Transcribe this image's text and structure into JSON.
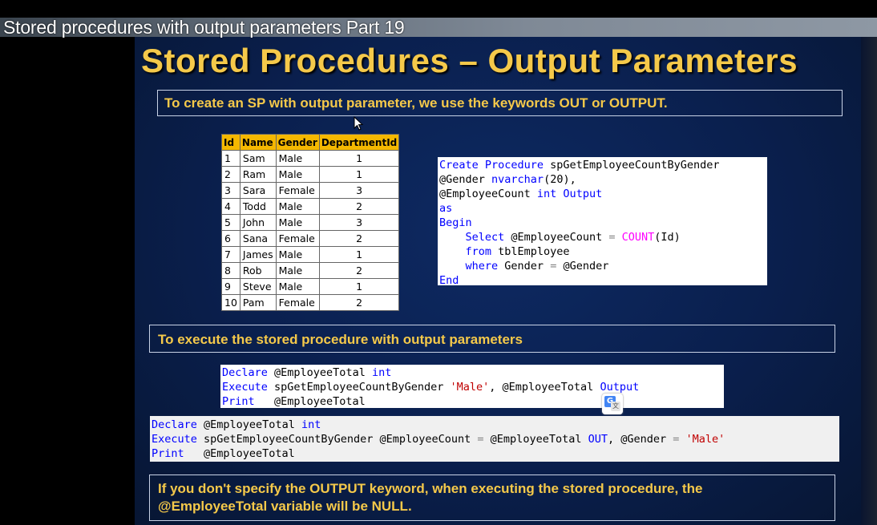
{
  "video": {
    "title": "Stored procedures with output parameters Part 19"
  },
  "slide": {
    "heading": "Stored Procedures – Output Parameters",
    "intro": "To create an SP with output parameter, we use the keywords OUT or OUTPUT.",
    "execute_heading": "To execute the stored procedure with output parameters",
    "note_line1": "If you don't specify the OUTPUT keyword, when executing the stored procedure, the",
    "note_line2": "@EmployeeTotal variable will be NULL."
  },
  "table": {
    "headers": [
      "Id",
      "Name",
      "Gender",
      "DepartmentId"
    ],
    "rows": [
      [
        "1",
        "Sam",
        "Male",
        "1"
      ],
      [
        "2",
        "Ram",
        "Male",
        "1"
      ],
      [
        "3",
        "Sara",
        "Female",
        "3"
      ],
      [
        "4",
        "Todd",
        "Male",
        "2"
      ],
      [
        "5",
        "John",
        "Male",
        "3"
      ],
      [
        "6",
        "Sana",
        "Female",
        "2"
      ],
      [
        "7",
        "James",
        "Male",
        "1"
      ],
      [
        "8",
        "Rob",
        "Male",
        "2"
      ],
      [
        "9",
        "Steve",
        "Male",
        "1"
      ],
      [
        "10",
        "Pam",
        "Female",
        "2"
      ]
    ]
  },
  "code_create": {
    "l1_kw": "Create Procedure",
    "l1_rest": " spGetEmployeeCountByGender",
    "l2_a": "@Gender ",
    "l2_kw": "nvarchar",
    "l2_b": "(20),",
    "l3_a": "@EmployeeCount ",
    "l3_kw": "int Output",
    "l4_kw": "as",
    "l5_kw": "Begin",
    "l6_kw": "Select",
    "l6_a": " @EmployeeCount ",
    "l6_op": "=",
    "l6_fn": " COUNT",
    "l6_b": "(Id)",
    "l7_kw": "from",
    "l7_a": " tblEmployee",
    "l8_kw": "where",
    "l8_a": " Gender ",
    "l8_op": "=",
    "l8_b": " @Gender",
    "l9_kw": "End"
  },
  "code_exec1": {
    "l1_kw": "Declare",
    "l1_a": " @EmployeeTotal ",
    "l1_kw2": "int",
    "l2_kw": "Execute",
    "l2_a": " spGetEmployeeCountByGender ",
    "l2_str": "'Male'",
    "l2_b": ", @EmployeeTotal ",
    "l2_kw2": "Output",
    "l3_kw": "Print",
    "l3_a": "   @EmployeeTotal"
  },
  "code_exec2": {
    "l1_kw": "Declare",
    "l1_a": " @EmployeeTotal ",
    "l1_kw2": "int",
    "l2_kw": "Execute",
    "l2_a": " spGetEmployeeCountByGender @EmployeeCount ",
    "l2_op": "=",
    "l2_b": " @EmployeeTotal ",
    "l2_kw2": "OUT",
    "l2_c": ", @Gender ",
    "l2_op2": "=",
    "l2_str": " 'Male'",
    "l3_kw": "Print",
    "l3_a": "   @EmployeeTotal"
  },
  "icons": {
    "translate": "google-translate-icon",
    "cursor": "mouse-pointer-icon"
  },
  "colors": {
    "heading": "#f5c94a",
    "slide_bg": "#0a1f4d",
    "table_header": "#f5b800",
    "keyword": "#0000ff",
    "function": "#ff00ff",
    "string": "#c00000"
  }
}
